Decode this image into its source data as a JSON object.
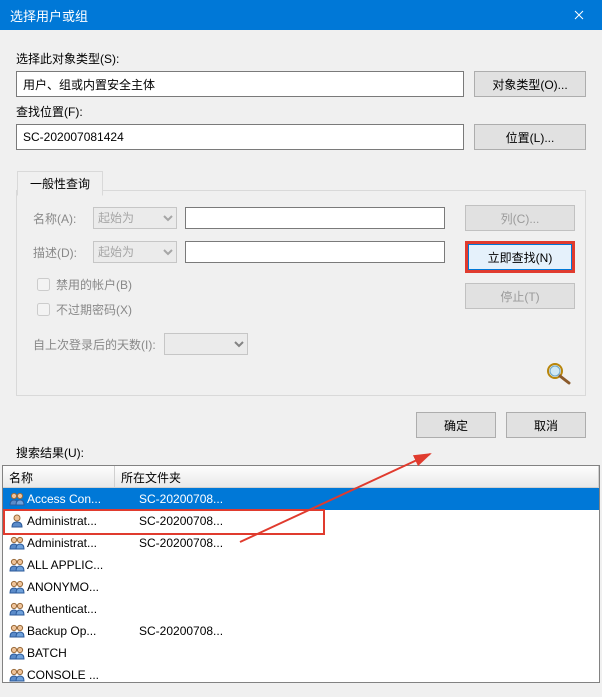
{
  "titlebar": {
    "title": "选择用户或组"
  },
  "section1": {
    "label": "选择此对象类型(S):",
    "value": "用户、组或内置安全主体",
    "btn": "对象类型(O)..."
  },
  "section2": {
    "label": "查找位置(F):",
    "value": "SC-202007081424",
    "btn": "位置(L)..."
  },
  "tab": {
    "label": "一般性查询"
  },
  "form": {
    "nameLabel": "名称(A):",
    "nameMode": "起始为",
    "descLabel": "描述(D):",
    "descMode": "起始为",
    "chk1": "禁用的帐户(B)",
    "chk2": "不过期密码(X)",
    "daysLabel": "自上次登录后的天数(I):"
  },
  "rightButtons": {
    "columns": "列(C)...",
    "findNow": "立即查找(N)",
    "stop": "停止(T)"
  },
  "okCancel": {
    "ok": "确定",
    "cancel": "取消"
  },
  "results": {
    "label": "搜索结果(U):",
    "headers": {
      "name": "名称",
      "folder": "所在文件夹"
    },
    "rows": [
      {
        "icon": "group",
        "name": "Access Con...",
        "folder": "SC-20200708...",
        "selected": true
      },
      {
        "icon": "user",
        "name": "Administrat...",
        "folder": "SC-20200708...",
        "highlight": true
      },
      {
        "icon": "group",
        "name": "Administrat...",
        "folder": "SC-20200708..."
      },
      {
        "icon": "group",
        "name": "ALL APPLIC...",
        "folder": ""
      },
      {
        "icon": "group",
        "name": "ANONYMO...",
        "folder": ""
      },
      {
        "icon": "group",
        "name": "Authenticat...",
        "folder": ""
      },
      {
        "icon": "group",
        "name": "Backup Op...",
        "folder": "SC-20200708..."
      },
      {
        "icon": "group",
        "name": "BATCH",
        "folder": ""
      },
      {
        "icon": "group",
        "name": "CONSOLE ...",
        "folder": ""
      }
    ]
  }
}
